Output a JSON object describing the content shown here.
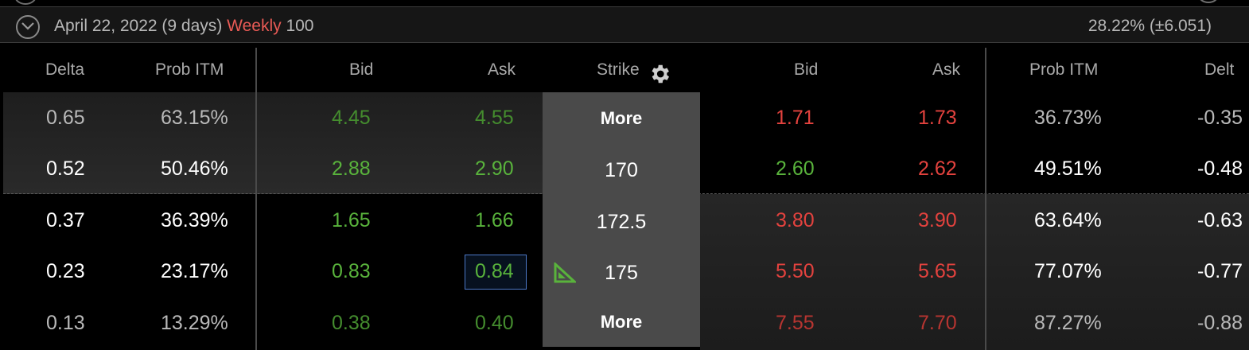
{
  "expiration": {
    "date_label": "April 22, 2022 (9 days)",
    "cycle_label": "Weekly",
    "size_label": "100",
    "iv_label": "28.22% (±6.051)"
  },
  "columns": {
    "delta": "Delta",
    "prob_itm": "Prob ITM",
    "call_bid": "Bid",
    "call_ask": "Ask",
    "strike": "Strike",
    "put_bid": "Bid",
    "put_ask": "Ask",
    "put_prob_itm": "Prob ITM",
    "put_delta": "Delt"
  },
  "rows": [
    {
      "delta": "0.65",
      "prob_itm": "63.15%",
      "call_bid": "4.45",
      "call_ask": "4.55",
      "strike": "More",
      "put_bid": "1.71",
      "put_ask": "1.73",
      "put_prob_itm": "36.73%",
      "put_delta": "-0.35"
    },
    {
      "delta": "0.52",
      "prob_itm": "50.46%",
      "call_bid": "2.88",
      "call_ask": "2.90",
      "strike": "170",
      "put_bid": "2.60",
      "put_ask": "2.62",
      "put_prob_itm": "49.51%",
      "put_delta": "-0.48"
    },
    {
      "delta": "0.37",
      "prob_itm": "36.39%",
      "call_bid": "1.65",
      "call_ask": "1.66",
      "strike": "172.5",
      "put_bid": "3.80",
      "put_ask": "3.90",
      "put_prob_itm": "63.64%",
      "put_delta": "-0.63"
    },
    {
      "delta": "0.23",
      "prob_itm": "23.17%",
      "call_bid": "0.83",
      "call_ask": "0.84",
      "strike": "175",
      "put_bid": "5.50",
      "put_ask": "5.65",
      "put_prob_itm": "77.07%",
      "put_delta": "-0.77"
    },
    {
      "delta": "0.13",
      "prob_itm": "13.29%",
      "call_bid": "0.38",
      "call_ask": "0.40",
      "strike": "More",
      "put_bid": "7.55",
      "put_ask": "7.70",
      "put_prob_itm": "87.27%",
      "put_delta": "-0.88"
    }
  ],
  "colors": {
    "accent_up": "#59b33c",
    "accent_down": "#e3423e",
    "weekly": "#e85a55",
    "selection_border": "#4d79c8"
  },
  "icons": {
    "collapse": "chevron-down-circle-icon",
    "settings": "gear-icon",
    "selected_strike": "triangle-flag-icon"
  }
}
